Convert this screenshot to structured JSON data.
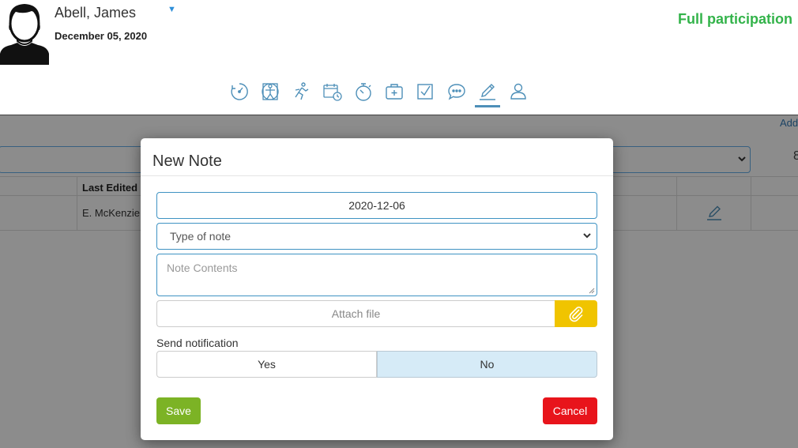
{
  "header": {
    "patient_name": "Abell, James",
    "dropdown_caret": "▼",
    "date": "December 05, 2020",
    "status": "Full participation"
  },
  "nav": {
    "active": "notes",
    "icons": [
      "recovery-gauge-icon",
      "body-chart-icon",
      "activity-runner-icon",
      "calendar-clock-icon",
      "stopwatch-icon",
      "medical-kit-icon",
      "checklist-icon",
      "chat-bubble-icon",
      "pencil-notes-icon",
      "person-icon"
    ]
  },
  "background": {
    "add_link": "Add",
    "column_last_edited": "Last Edited",
    "row_editor": "E. McKenzie",
    "fragment": "8"
  },
  "modal": {
    "title": "New Note",
    "date_value": "2020-12-06",
    "type_placeholder": "Type of note",
    "contents_placeholder": "Note Contents",
    "attach_label": "Attach file",
    "notification_label": "Send notification",
    "yes_label": "Yes",
    "no_label": "No",
    "selected_notification": "No",
    "save_label": "Save",
    "cancel_label": "Cancel"
  },
  "colors": {
    "status_green": "#33b34a",
    "nav_blue": "#4d8fb8",
    "save_green": "#7cb325",
    "cancel_red": "#e8141b",
    "attach_yellow": "#f0c400",
    "selected_toggle": "#d6ebf7"
  }
}
